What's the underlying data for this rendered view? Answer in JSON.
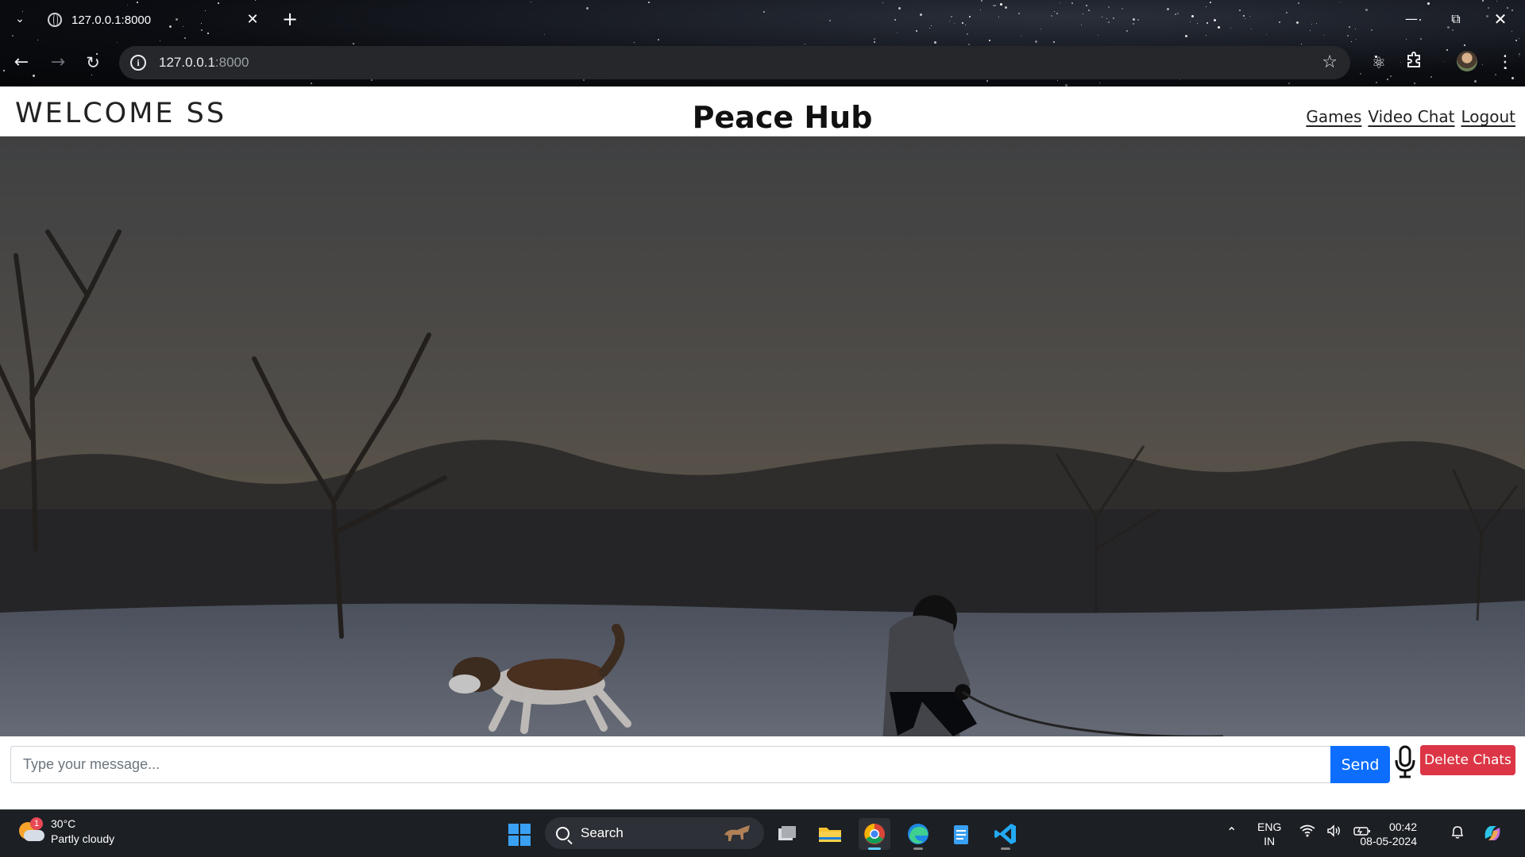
{
  "browser": {
    "tab_title": "127.0.0.1:8000",
    "url_host": "127.0.0.1",
    "url_port": ":8000"
  },
  "navbar": {
    "welcome": "WELCOME SS",
    "brand": "Peace Hub",
    "links": [
      "Games",
      "Video Chat",
      "Logout"
    ]
  },
  "chat": {
    "placeholder": "Type your message...",
    "send_label": "Send",
    "delete_label": "Delete Chats"
  },
  "taskbar": {
    "weather_badge": "1",
    "temperature": "30°C",
    "condition": "Partly cloudy",
    "search_label": "Search",
    "lang_top": "ENG",
    "lang_bottom": "IN",
    "time": "00:42",
    "date": "08-05-2024"
  },
  "colors": {
    "send_button": "#0d6efd",
    "delete_button": "#dc3545",
    "taskbar": "#1c1f24"
  }
}
